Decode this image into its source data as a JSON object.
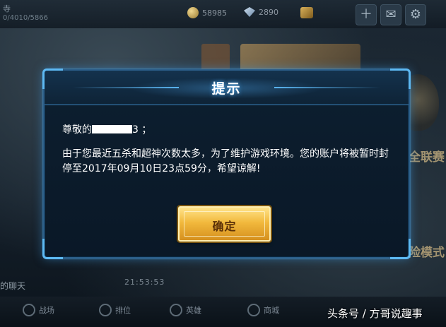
{
  "background": {
    "player_name": "寺",
    "player_id": "0/4010/5866",
    "currency": [
      {
        "icon": "gold-coin-icon",
        "amount": "58985"
      },
      {
        "icon": "diamond-icon",
        "amount": "2890"
      }
    ],
    "side_labels": [
      "全联赛",
      "险模式"
    ],
    "chat_label": "的聊天",
    "chat_time": "21:53:53",
    "nav_items": [
      "战场",
      "排位",
      "英雄",
      "商城"
    ]
  },
  "dialog": {
    "title": "提示",
    "greeting_prefix": "尊敬的",
    "greeting_suffix": "3 ；",
    "message": "由于您最近五杀和超神次数太多，为了维护游戏环境。您的账户将被暂时封停至2017年09月10日23点59分，希望谅解!",
    "confirm_label": "确定"
  },
  "watermark": "头条号 / 方哥说趣事",
  "colors": {
    "dialog_border": "#2c5f8a",
    "dialog_glow": "#5ab3f0",
    "button_gold": "#f2b93d",
    "button_text": "#5a2f08"
  }
}
